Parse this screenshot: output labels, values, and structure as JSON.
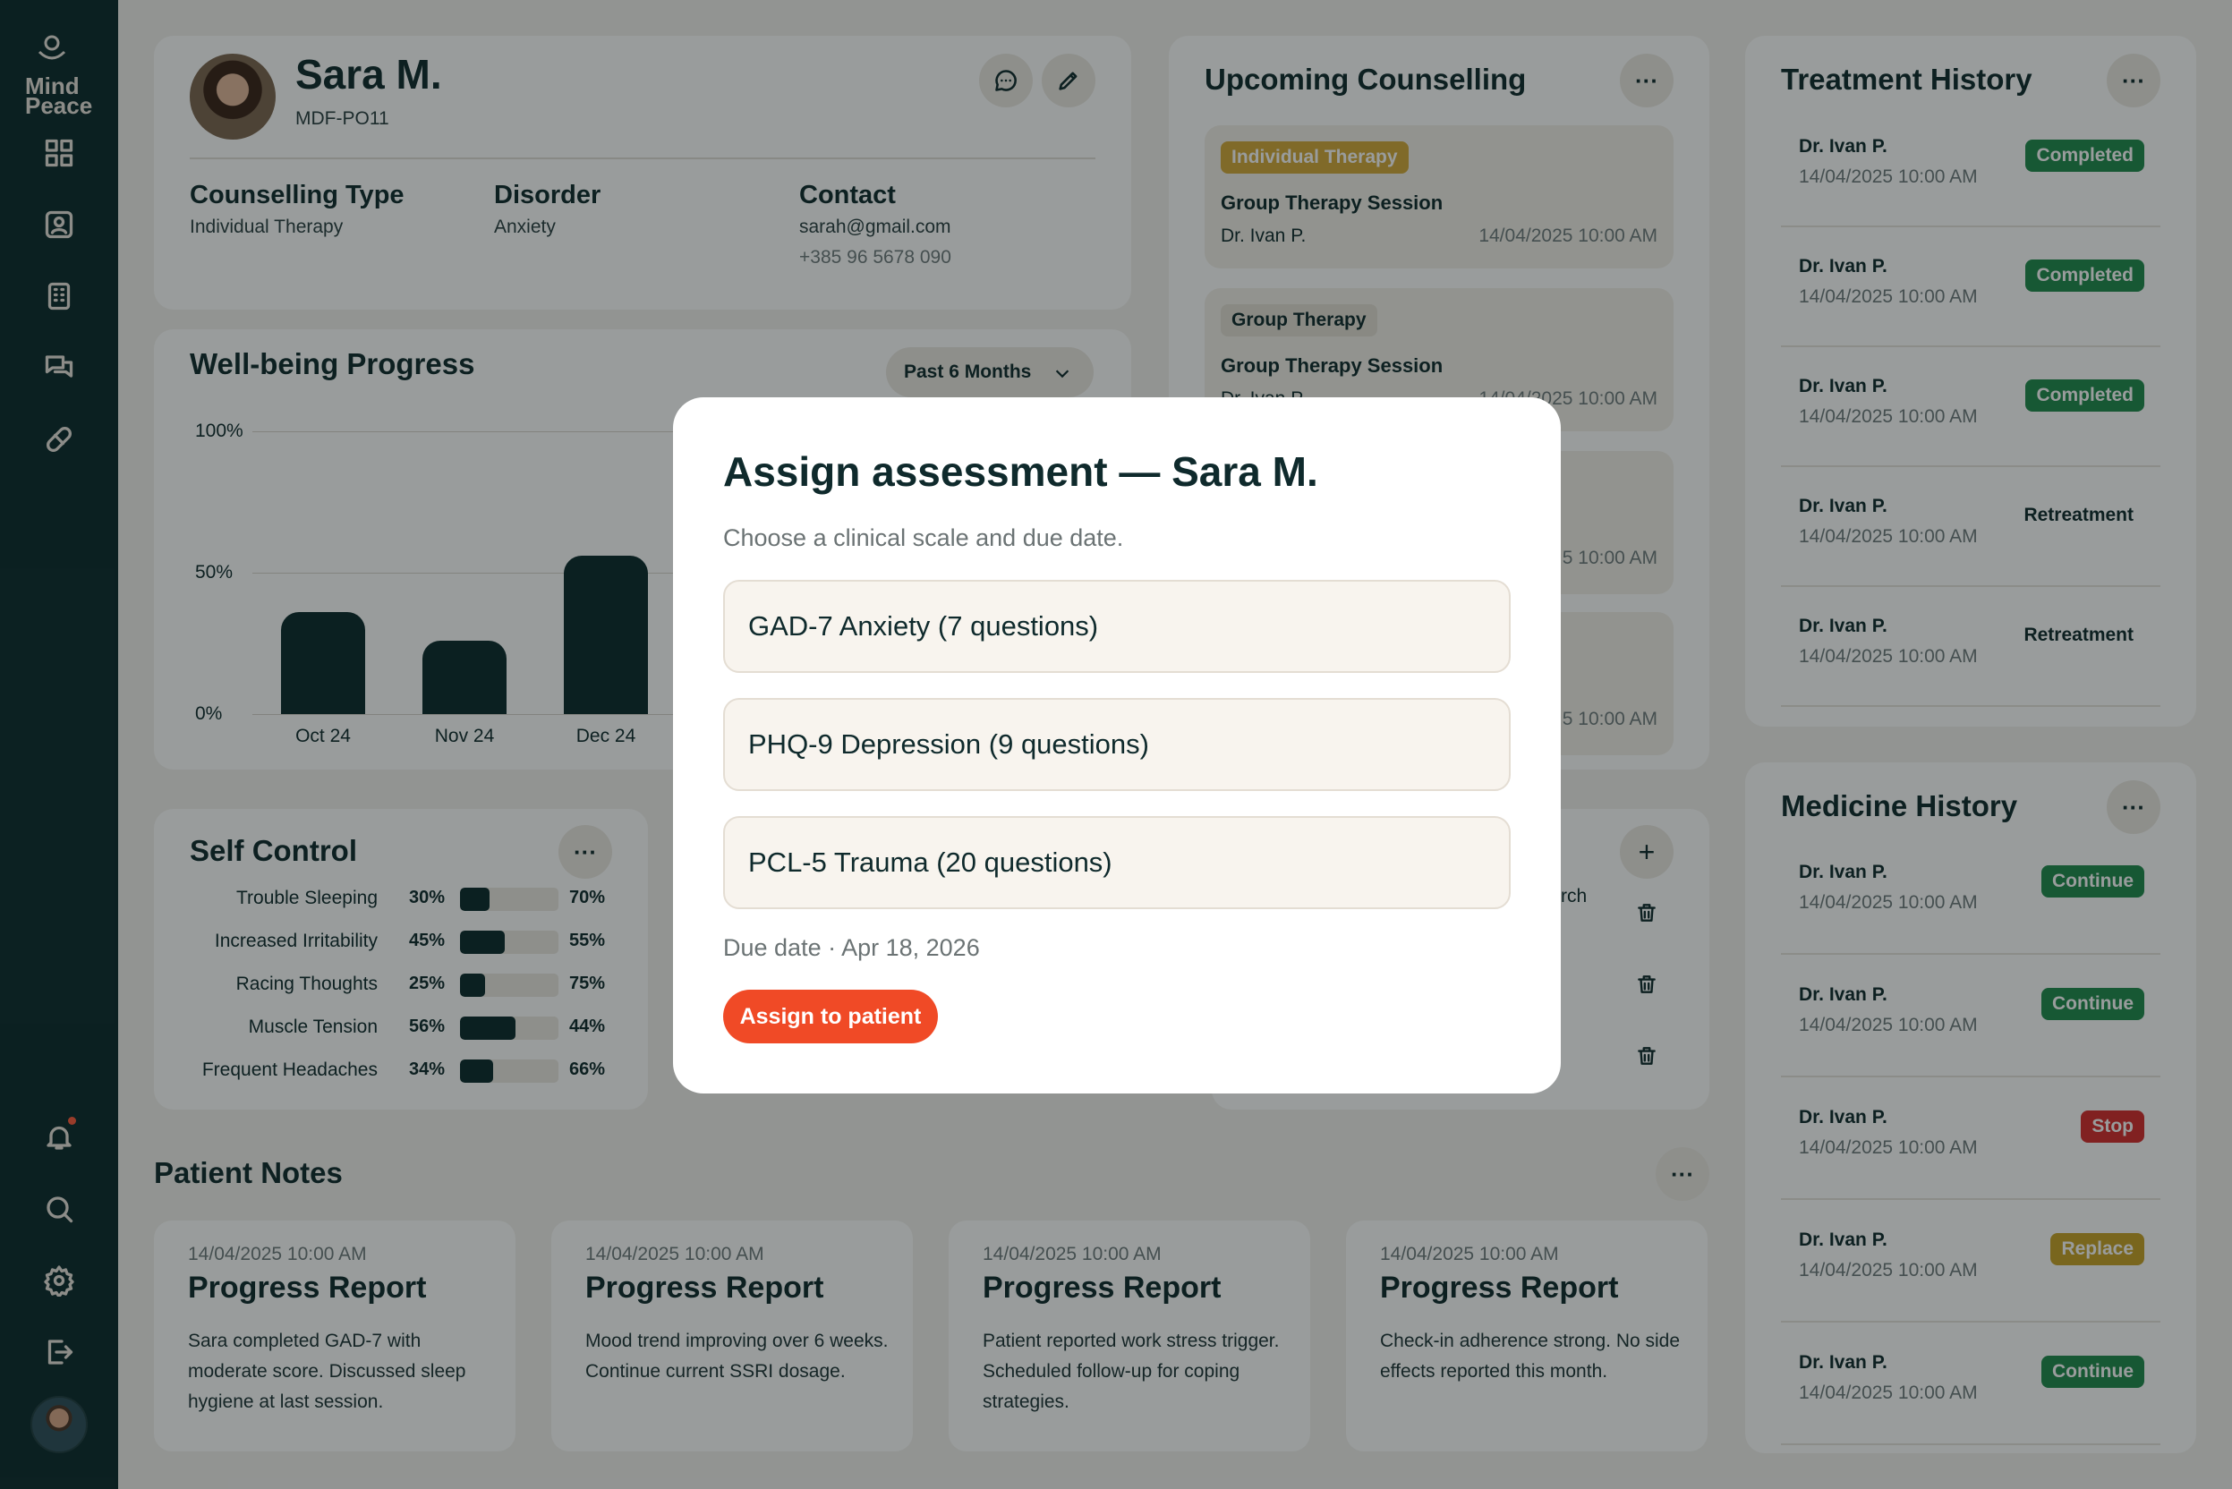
{
  "app": {
    "logo_line1": "Mind",
    "logo_line2": "Peace"
  },
  "colors": {
    "sidebar": "#0c2a2c",
    "accent": "#f04a26",
    "completed": "#1f8a4c",
    "stop": "#d62b2b",
    "replace": "#c9a227",
    "tag_individual": "#d4a93a"
  },
  "sidebar": {
    "top_icons": [
      "dashboard-icon",
      "patient-icon",
      "building-icon",
      "chat-icon",
      "pill-icon"
    ],
    "bottom_icons": [
      "bell-icon",
      "search-icon",
      "gear-icon",
      "logout-icon"
    ]
  },
  "profile": {
    "name": "Sara M.",
    "id": "MDF-PO11",
    "counselling_type_label": "Counselling Type",
    "counselling_type": "Individual Therapy",
    "disorder_label": "Disorder",
    "disorder": "Anxiety",
    "contact_label": "Contact",
    "email": "sarah@gmail.com",
    "phone": "+385 96 5678 090"
  },
  "wellbeing": {
    "title": "Well-being Progress",
    "filter": "Past 6 Months"
  },
  "chart_data": {
    "type": "bar",
    "categories": [
      "Oct 24",
      "Nov 24",
      "Dec 24"
    ],
    "values": [
      36,
      26,
      56
    ],
    "y_ticks": [
      "100%",
      "50%",
      "0%"
    ],
    "ylim": [
      0,
      100
    ],
    "grid": true
  },
  "self_control": {
    "title": "Self Control",
    "items": [
      {
        "label": "Trouble Sleeping",
        "left": "30%",
        "right": "70%",
        "value": 30
      },
      {
        "label": "Increased Irritability",
        "left": "45%",
        "right": "55%",
        "value": 45
      },
      {
        "label": "Racing Thoughts",
        "left": "25%",
        "right": "75%",
        "value": 25
      },
      {
        "label": "Muscle Tension",
        "left": "56%",
        "right": "44%",
        "value": 56
      },
      {
        "label": "Frequent Headaches",
        "left": "34%",
        "right": "66%",
        "value": 34
      }
    ]
  },
  "upcoming": {
    "title": "Upcoming Counselling",
    "items": [
      {
        "tag": "Individual Therapy",
        "title": "Group Therapy Session",
        "doctor": "Dr. Ivan P.",
        "time": "14/04/2025 10:00 AM"
      },
      {
        "tag": "Group Therapy",
        "title": "Group Therapy Session",
        "doctor": "Dr. Ivan P.",
        "time": "14/04/2025 10:00 AM"
      },
      {
        "time": "5 10:00 AM"
      },
      {
        "time": "5 10:00 AM"
      }
    ]
  },
  "hidden_card": {
    "fragment": "rch"
  },
  "treatment": {
    "title": "Treatment History",
    "items": [
      {
        "doctor": "Dr. Ivan P.",
        "time": "14/04/2025 10:00 AM",
        "status": "Completed"
      },
      {
        "doctor": "Dr. Ivan P.",
        "time": "14/04/2025 10:00 AM",
        "status": "Completed"
      },
      {
        "doctor": "Dr. Ivan P.",
        "time": "14/04/2025 10:00 AM",
        "status": "Completed"
      },
      {
        "doctor": "Dr. Ivan P.",
        "time": "14/04/2025 10:00 AM",
        "status": "Retreatment"
      },
      {
        "doctor": "Dr. Ivan P.",
        "time": "14/04/2025 10:00 AM",
        "status": "Retreatment"
      }
    ]
  },
  "medicine": {
    "title": "Medicine History",
    "items": [
      {
        "doctor": "Dr. Ivan P.",
        "time": "14/04/2025 10:00 AM",
        "status": "Continue"
      },
      {
        "doctor": "Dr. Ivan P.",
        "time": "14/04/2025 10:00 AM",
        "status": "Continue"
      },
      {
        "doctor": "Dr. Ivan P.",
        "time": "14/04/2025 10:00 AM",
        "status": "Stop"
      },
      {
        "doctor": "Dr. Ivan P.",
        "time": "14/04/2025 10:00 AM",
        "status": "Replace"
      },
      {
        "doctor": "Dr. Ivan P.",
        "time": "14/04/2025 10:00 AM",
        "status": "Continue"
      }
    ]
  },
  "notes": {
    "title": "Patient Notes",
    "items": [
      {
        "time": "14/04/2025 10:00 AM",
        "title": "Progress Report",
        "body": "Sara completed GAD-7 with moderate score. Discussed sleep hygiene at last session."
      },
      {
        "time": "14/04/2025 10:00 AM",
        "title": "Progress Report",
        "body": "Mood trend improving over 6 weeks. Continue current SSRI dosage."
      },
      {
        "time": "14/04/2025 10:00 AM",
        "title": "Progress Report",
        "body": "Patient reported work stress trigger. Scheduled follow-up for coping strategies."
      },
      {
        "time": "14/04/2025 10:00 AM",
        "title": "Progress Report",
        "body": "Check-in adherence strong. No side effects reported this month."
      }
    ]
  },
  "modal": {
    "title": "Assign assessment — Sara M.",
    "subtitle": "Choose a clinical scale and due date.",
    "options": [
      "GAD-7 Anxiety (7 questions)",
      "PHQ-9 Depression (9 questions)",
      "PCL-5 Trauma (20 questions)"
    ],
    "due_date": "Due date · Apr 18, 2026",
    "button": "Assign to patient"
  }
}
